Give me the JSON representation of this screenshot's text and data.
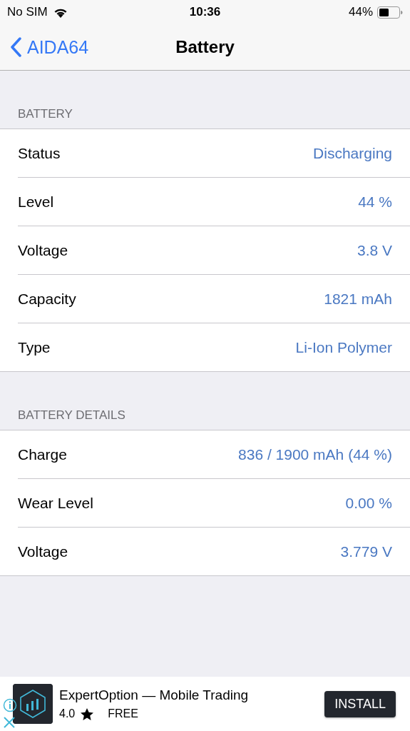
{
  "status_bar": {
    "carrier": "No SIM",
    "time": "10:36",
    "battery": "44%"
  },
  "nav": {
    "back": "AIDA64",
    "title": "Battery"
  },
  "sections": [
    {
      "header": "BATTERY",
      "rows": [
        {
          "label": "Status",
          "value": "Discharging"
        },
        {
          "label": "Level",
          "value": "44 %"
        },
        {
          "label": "Voltage",
          "value": "3.8 V"
        },
        {
          "label": "Capacity",
          "value": "1821 mAh"
        },
        {
          "label": "Type",
          "value": "Li-Ion Polymer"
        }
      ]
    },
    {
      "header": "BATTERY DETAILS",
      "rows": [
        {
          "label": "Charge",
          "value": "836 / 1900 mAh (44 %)"
        },
        {
          "label": "Wear Level",
          "value": "0.00 %"
        },
        {
          "label": "Voltage",
          "value": "3.779 V"
        }
      ]
    }
  ],
  "ad": {
    "title": "ExpertOption — Mobile Trading",
    "rating": "4.0",
    "price": "FREE",
    "button": "INSTALL"
  }
}
